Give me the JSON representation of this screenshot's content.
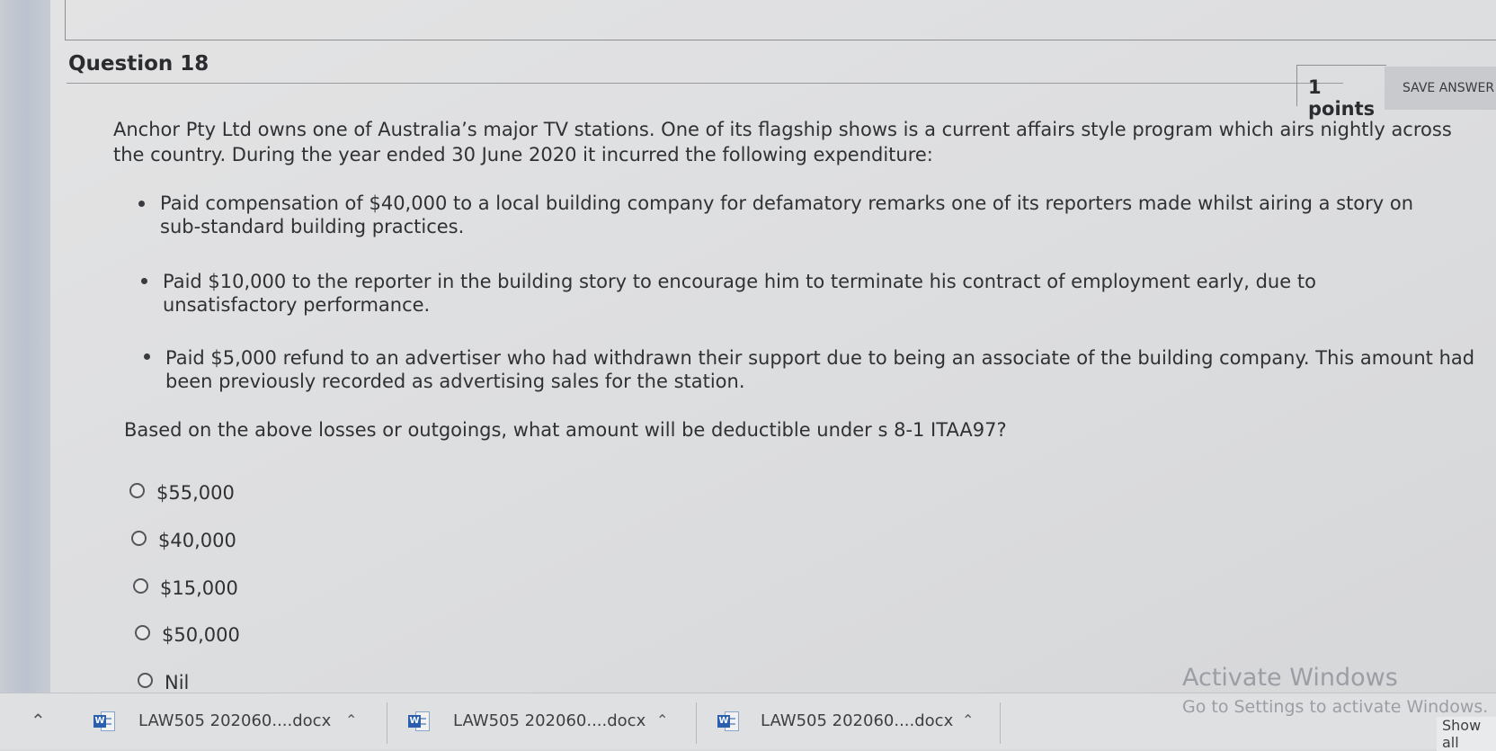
{
  "question": {
    "title": "Question 18",
    "points": "1 points",
    "save_label": "SAVE ANSWER",
    "intro": "Anchor Pty Ltd owns one of Australia’s major TV stations. One of its flagship shows is a current affairs style program which airs nightly across the country. During the year ended 30 June 2020 it incurred the following expenditure:",
    "bullets": [
      "Paid compensation of $40,000 to a local building company for defamatory remarks one of its reporters made whilst airing a story on sub-standard building practices.",
      "Paid $10,000 to the reporter in the building story to encourage him to terminate his contract of employment early, due to unsatisfactory performance.",
      "Paid $5,000 refund to an advertiser who had withdrawn their support due to being an associate of the building company. This amount had been previously recorded as advertising sales for the station."
    ],
    "prompt": "Based on the above losses or outgoings, what amount will be deductible under s 8-1 ITAA97?",
    "options": [
      "$55,000",
      "$40,000",
      "$15,000",
      "$50,000",
      "Nil"
    ]
  },
  "watermark": {
    "title": "Activate Windows",
    "subtitle": "Go to Settings to activate Windows."
  },
  "taskbar": {
    "downloads": [
      {
        "name": "LAW505 202060....docx",
        "icon": "word-icon"
      },
      {
        "name": "LAW505 202060....docx",
        "icon": "word-icon"
      },
      {
        "name": "LAW505 202060....docx",
        "icon": "word-icon"
      }
    ],
    "show_all": "Show all"
  }
}
